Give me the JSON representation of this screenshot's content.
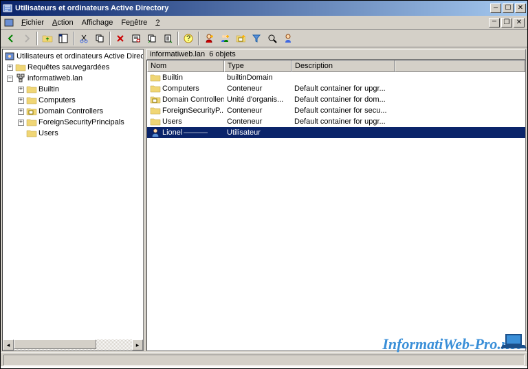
{
  "window": {
    "title": "Utilisateurs et ordinateurs Active Directory"
  },
  "menu": {
    "file": "Fichier",
    "action": "Action",
    "view": "Affichage",
    "window": "Fenêtre",
    "help": "?"
  },
  "tree": {
    "root": "Utilisateurs et ordinateurs Active Direc",
    "saved_queries": "Requêtes sauvegardées",
    "domain": "informatiweb.lan",
    "children": {
      "builtin": "Builtin",
      "computers": "Computers",
      "domain_controllers": "Domain Controllers",
      "fsp": "ForeignSecurityPrincipals",
      "users": "Users"
    }
  },
  "list": {
    "header_path": "informatiweb.lan",
    "header_count": "6 objets",
    "columns": {
      "name": "Nom",
      "type": "Type",
      "desc": "Description"
    },
    "rows": [
      {
        "name": "Builtin",
        "type": "builtinDomain",
        "desc": "",
        "icon": "folder"
      },
      {
        "name": "Computers",
        "type": "Conteneur",
        "desc": "Default container for upgr...",
        "icon": "folder"
      },
      {
        "name": "Domain Controllers",
        "type": "Unité d'organis...",
        "desc": "Default container for dom...",
        "icon": "ou"
      },
      {
        "name": "ForeignSecurityP...",
        "type": "Conteneur",
        "desc": "Default container for secu...",
        "icon": "folder"
      },
      {
        "name": "Users",
        "type": "Conteneur",
        "desc": "Default container for upgr...",
        "icon": "folder"
      },
      {
        "name": "Lionel",
        "type": "Utilisateur",
        "desc": "",
        "icon": "user",
        "selected": true
      }
    ]
  },
  "watermark": "InformatiWeb-Pro.net"
}
